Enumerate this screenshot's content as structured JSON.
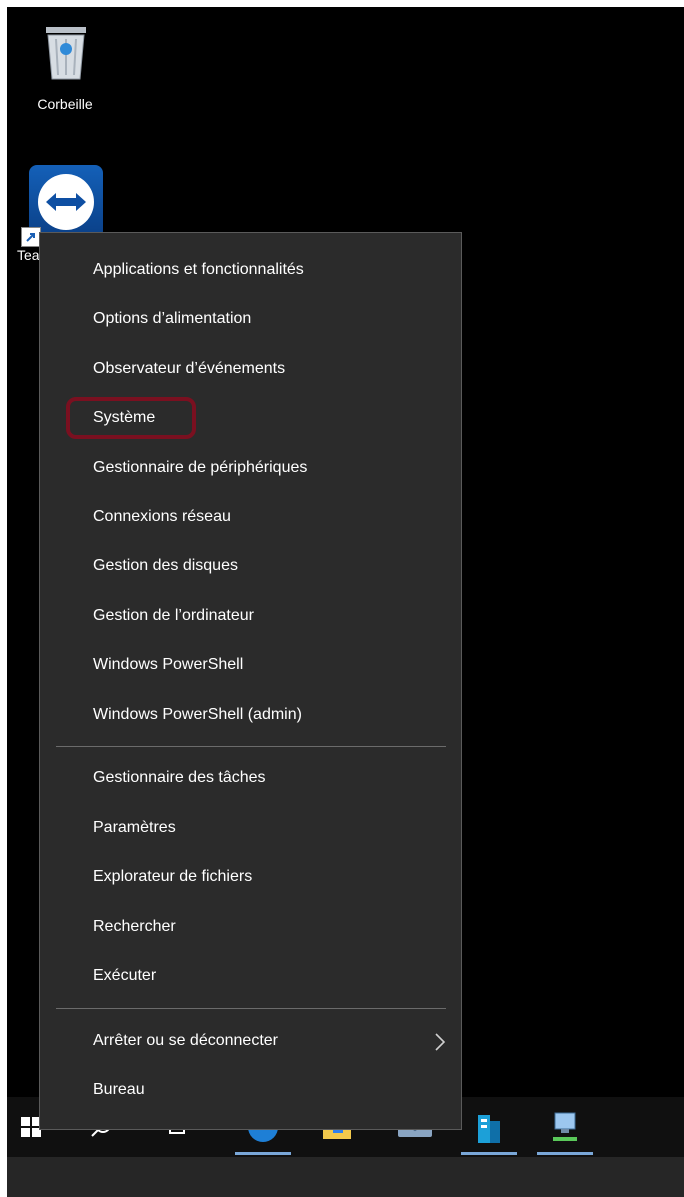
{
  "desktop": {
    "icons": [
      {
        "label": "Corbeille",
        "icon": "recycle-bin-icon"
      },
      {
        "label": "Tea",
        "icon": "teamviewer-icon"
      }
    ]
  },
  "context_menu": {
    "group1": [
      "Applications et fonctionnalités",
      "Options d’alimentation",
      "Observateur d’événements",
      "Système",
      "Gestionnaire de périphériques",
      "Connexions réseau",
      "Gestion des disques",
      "Gestion de l’ordinateur",
      "Windows PowerShell",
      "Windows PowerShell (admin)"
    ],
    "group2": [
      "Gestionnaire des tâches",
      "Paramètres",
      "Explorateur de fichiers",
      "Rechercher",
      "Exécuter"
    ],
    "group3": [
      "Arrêter ou se déconnecter",
      "Bureau"
    ],
    "highlighted_item": "Système",
    "highlight_color": "#7a1020"
  },
  "taskbar": {
    "items": [
      "windows-start-icon",
      "search-icon",
      "task-view-icon",
      "edge-icon",
      "file-explorer-icon",
      "mail-icon",
      "server-manager-icon",
      "network-computer-icon"
    ]
  },
  "colors": {
    "menu_bg": "#2b2b2b",
    "desktop_bg": "#000000",
    "taskbar_bg": "#101010"
  }
}
